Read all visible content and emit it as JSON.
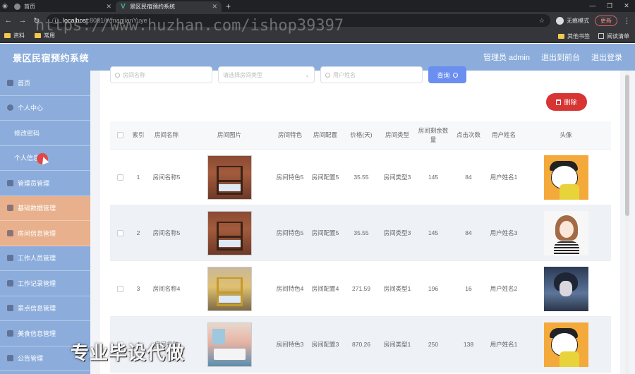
{
  "browser": {
    "tabs": [
      {
        "title": "首页",
        "active": false
      },
      {
        "title": "景区民宿预约系统",
        "active": true
      }
    ],
    "url_host": "localhost",
    "url_path": ":8081/#/fnagjianYuye",
    "incognito_label": "无痕模式",
    "update_label": "更新",
    "bookmarks": [
      "资料",
      "常用"
    ],
    "bookmarks_right": [
      "其他书签",
      "阅读清单"
    ]
  },
  "header": {
    "title": "景区民宿预约系统",
    "admin": "管理员 admin",
    "back_front": "退出到前台",
    "logout": "退出登录"
  },
  "sidebar": {
    "items": [
      {
        "label": "首页",
        "type": "top"
      },
      {
        "label": "个人中心",
        "type": "top"
      },
      {
        "label": "修改密码",
        "type": "sub"
      },
      {
        "label": "个人信息",
        "type": "sub"
      },
      {
        "label": "管理员管理",
        "type": "top"
      },
      {
        "label": "基础数据管理",
        "type": "top",
        "highlight": "orange"
      },
      {
        "label": "房间信息管理",
        "type": "top",
        "highlight": "orange"
      },
      {
        "label": "工作人员管理",
        "type": "top"
      },
      {
        "label": "工作记录管理",
        "type": "top"
      },
      {
        "label": "景点信息管理",
        "type": "top"
      },
      {
        "label": "美食信息管理",
        "type": "top"
      },
      {
        "label": "公告管理",
        "type": "top"
      }
    ]
  },
  "search": {
    "room_name_placeholder": "房间名称",
    "room_type_placeholder": "请选择房间类型",
    "user_name_placeholder": "用户姓名",
    "search_button": "查询"
  },
  "actions": {
    "delete_button": "删除"
  },
  "watermarks": {
    "url": "https://www.huzhan.com/ishop39397",
    "slogan": "专业毕设代做"
  },
  "table": {
    "headers": {
      "index": "索引",
      "room_name": "房间名称",
      "room_image": "房间图片",
      "feature": "房间特色",
      "config": "房间配置",
      "price": "价格(天)",
      "room_type": "房间类型",
      "remaining": "房间剩余数量",
      "clicks": "点击次数",
      "user_name": "用户姓名",
      "avatar": "头像"
    },
    "rows": [
      {
        "index": "1",
        "room_name": "房间名称5",
        "feature": "房间特色5",
        "config": "房间配置5",
        "price": "35.55",
        "room_type": "房间类型3",
        "remaining": "145",
        "clicks": "84",
        "user_name": "用户姓名1",
        "image": "bunk-brown",
        "avatar": "cartoon-orange"
      },
      {
        "index": "2",
        "room_name": "房间名称5",
        "feature": "房间特色5",
        "config": "房间配置5",
        "price": "35.55",
        "room_type": "房间类型3",
        "remaining": "145",
        "clicks": "84",
        "user_name": "用户姓名3",
        "image": "bunk-brown",
        "avatar": "girl-sketch"
      },
      {
        "index": "3",
        "room_name": "房间名称4",
        "feature": "房间特色4",
        "config": "房间配置4",
        "price": "271.59",
        "room_type": "房间类型1",
        "remaining": "196",
        "clicks": "16",
        "user_name": "用户姓名2",
        "image": "bunk-yellow",
        "avatar": "boy-anime"
      },
      {
        "index": "4",
        "room_name": "房间名称",
        "feature": "房间特色3",
        "config": "房间配置3",
        "price": "870.26",
        "room_type": "房间类型1",
        "remaining": "250",
        "clicks": "138",
        "user_name": "用户姓名1",
        "image": "room-pink",
        "avatar": "cartoon-orange"
      }
    ]
  },
  "colors": {
    "header_bg": "#8caddc",
    "sidebar_highlight": "#e8b08c",
    "search_button": "#6b8ff0",
    "delete_button": "#d73434"
  }
}
